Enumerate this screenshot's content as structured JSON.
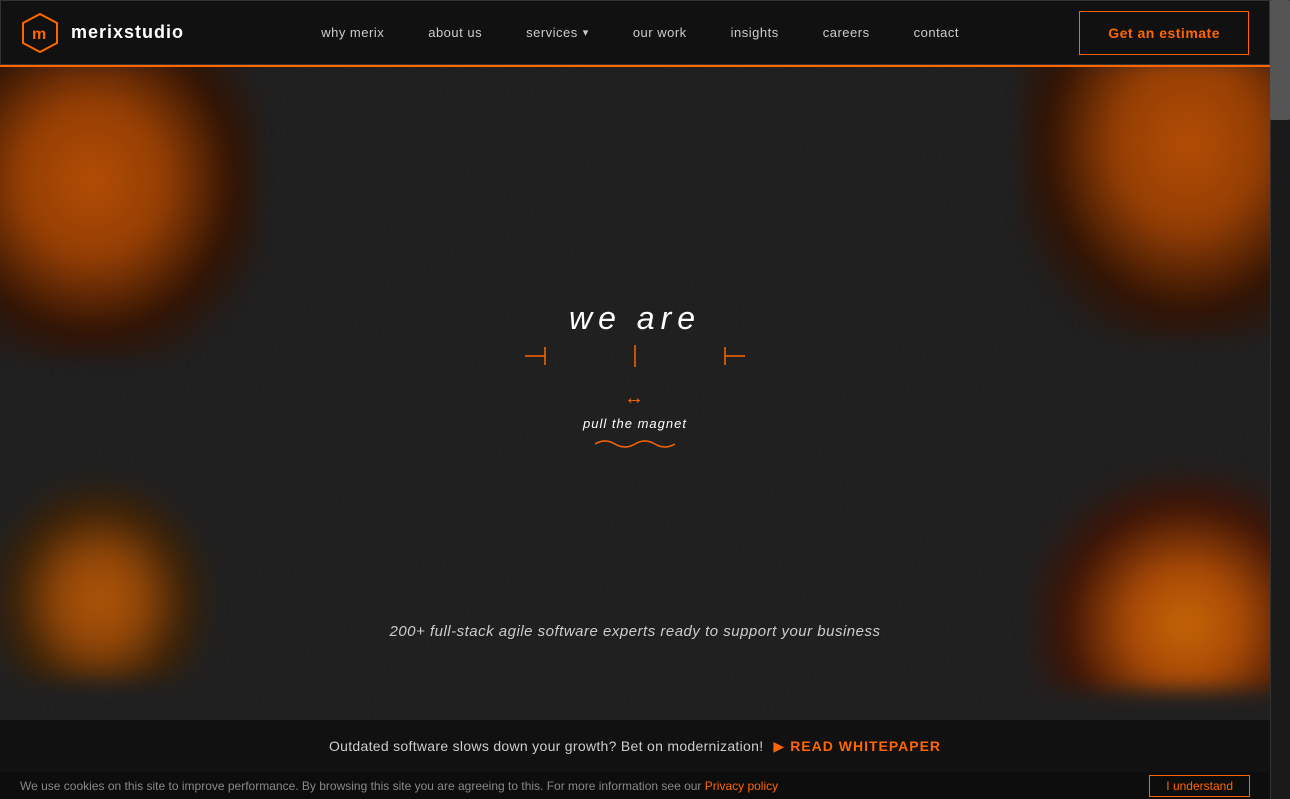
{
  "nav": {
    "logo_text": "merixstudio",
    "links": [
      {
        "id": "why-merix",
        "label": "why merix",
        "has_dropdown": false
      },
      {
        "id": "about-us",
        "label": "about us",
        "has_dropdown": false
      },
      {
        "id": "services",
        "label": "services",
        "has_dropdown": true
      },
      {
        "id": "our-work",
        "label": "our work",
        "has_dropdown": false
      },
      {
        "id": "insights",
        "label": "insights",
        "has_dropdown": false
      },
      {
        "id": "careers",
        "label": "careers",
        "has_dropdown": false
      },
      {
        "id": "contact",
        "label": "contact",
        "has_dropdown": false
      }
    ],
    "cta_label": "Get an estimate"
  },
  "hero": {
    "we_are": "we are",
    "magnet_arrow": "↔",
    "pull_the_magnet": "pull the magnet",
    "wave": "~~~",
    "tagline": "200+ full-stack agile software experts ready to support your business"
  },
  "banner": {
    "text": "Outdated software slows down your growth? Bet on modernization!",
    "cta_label": "READ WHITEPAPER"
  },
  "cookie": {
    "text": "We use cookies on this site to improve performance. By browsing this site you are agreeing to this. For more information see our",
    "link_text": "Privacy policy",
    "button_label": "I understand"
  }
}
